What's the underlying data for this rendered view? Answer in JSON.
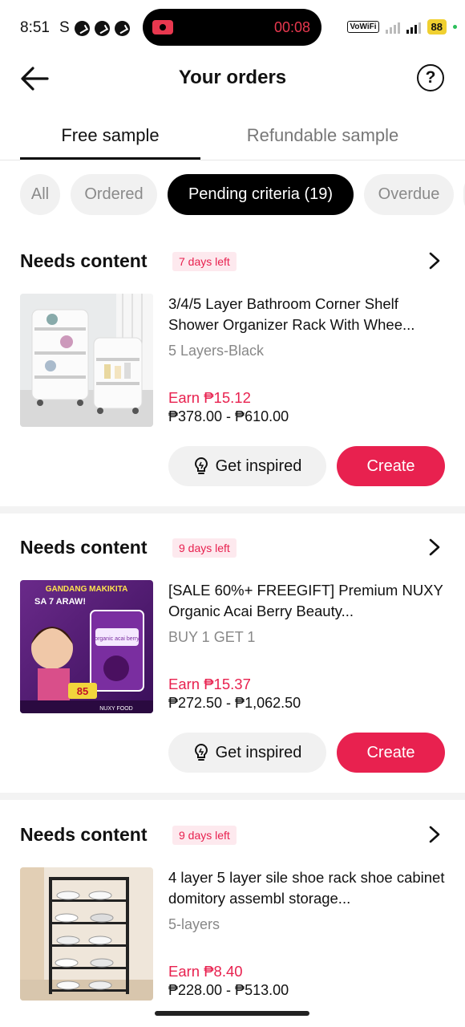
{
  "status_bar": {
    "time": "8:51",
    "s_letter": "S",
    "record_timer": "00:08",
    "vowifi": "VoWiFi",
    "battery": "88"
  },
  "header": {
    "title": "Your orders",
    "help_symbol": "?"
  },
  "tabs": [
    {
      "label": "Free sample",
      "active": true
    },
    {
      "label": "Refundable sample",
      "active": false
    }
  ],
  "filters": [
    {
      "label": "All",
      "selected": false
    },
    {
      "label": "Ordered",
      "selected": false
    },
    {
      "label": "Pending criteria (19)",
      "selected": true
    },
    {
      "label": "Overdue",
      "selected": false
    }
  ],
  "orders": [
    {
      "status": "Needs content",
      "days_left": "7 days left",
      "name": "3/4/5 Layer Bathroom Corner Shelf Shower Organizer Rack With Whee...",
      "variant": "5 Layers-Black",
      "earn": "Earn ₱15.12",
      "price_range": "₱378.00 - ₱610.00",
      "inspired_label": "Get inspired",
      "create_label": "Create"
    },
    {
      "status": "Needs content",
      "days_left": "9 days left",
      "name": "[SALE 60%+ FREEGIFT] Premium NUXY Organic Acai Berry Beauty...",
      "variant": "BUY 1 GET 1",
      "earn": "Earn ₱15.37",
      "price_range": "₱272.50 - ₱1,062.50",
      "inspired_label": "Get inspired",
      "create_label": "Create",
      "image_text": {
        "headline": "GANDANG MAKIKITA",
        "sub": "SA 7 ARAW!",
        "price_tag": "85",
        "brand": "NUXY FOOD",
        "pack": "organic acai berry"
      }
    },
    {
      "status": "Needs content",
      "days_left": "9 days left",
      "name": "4 layer 5 layer sile shoe rack shoe cabinet domitory assembl storage...",
      "variant": "5-layers",
      "earn": "Earn ₱8.40",
      "price_range": "₱228.00 - ₱513.00"
    }
  ]
}
